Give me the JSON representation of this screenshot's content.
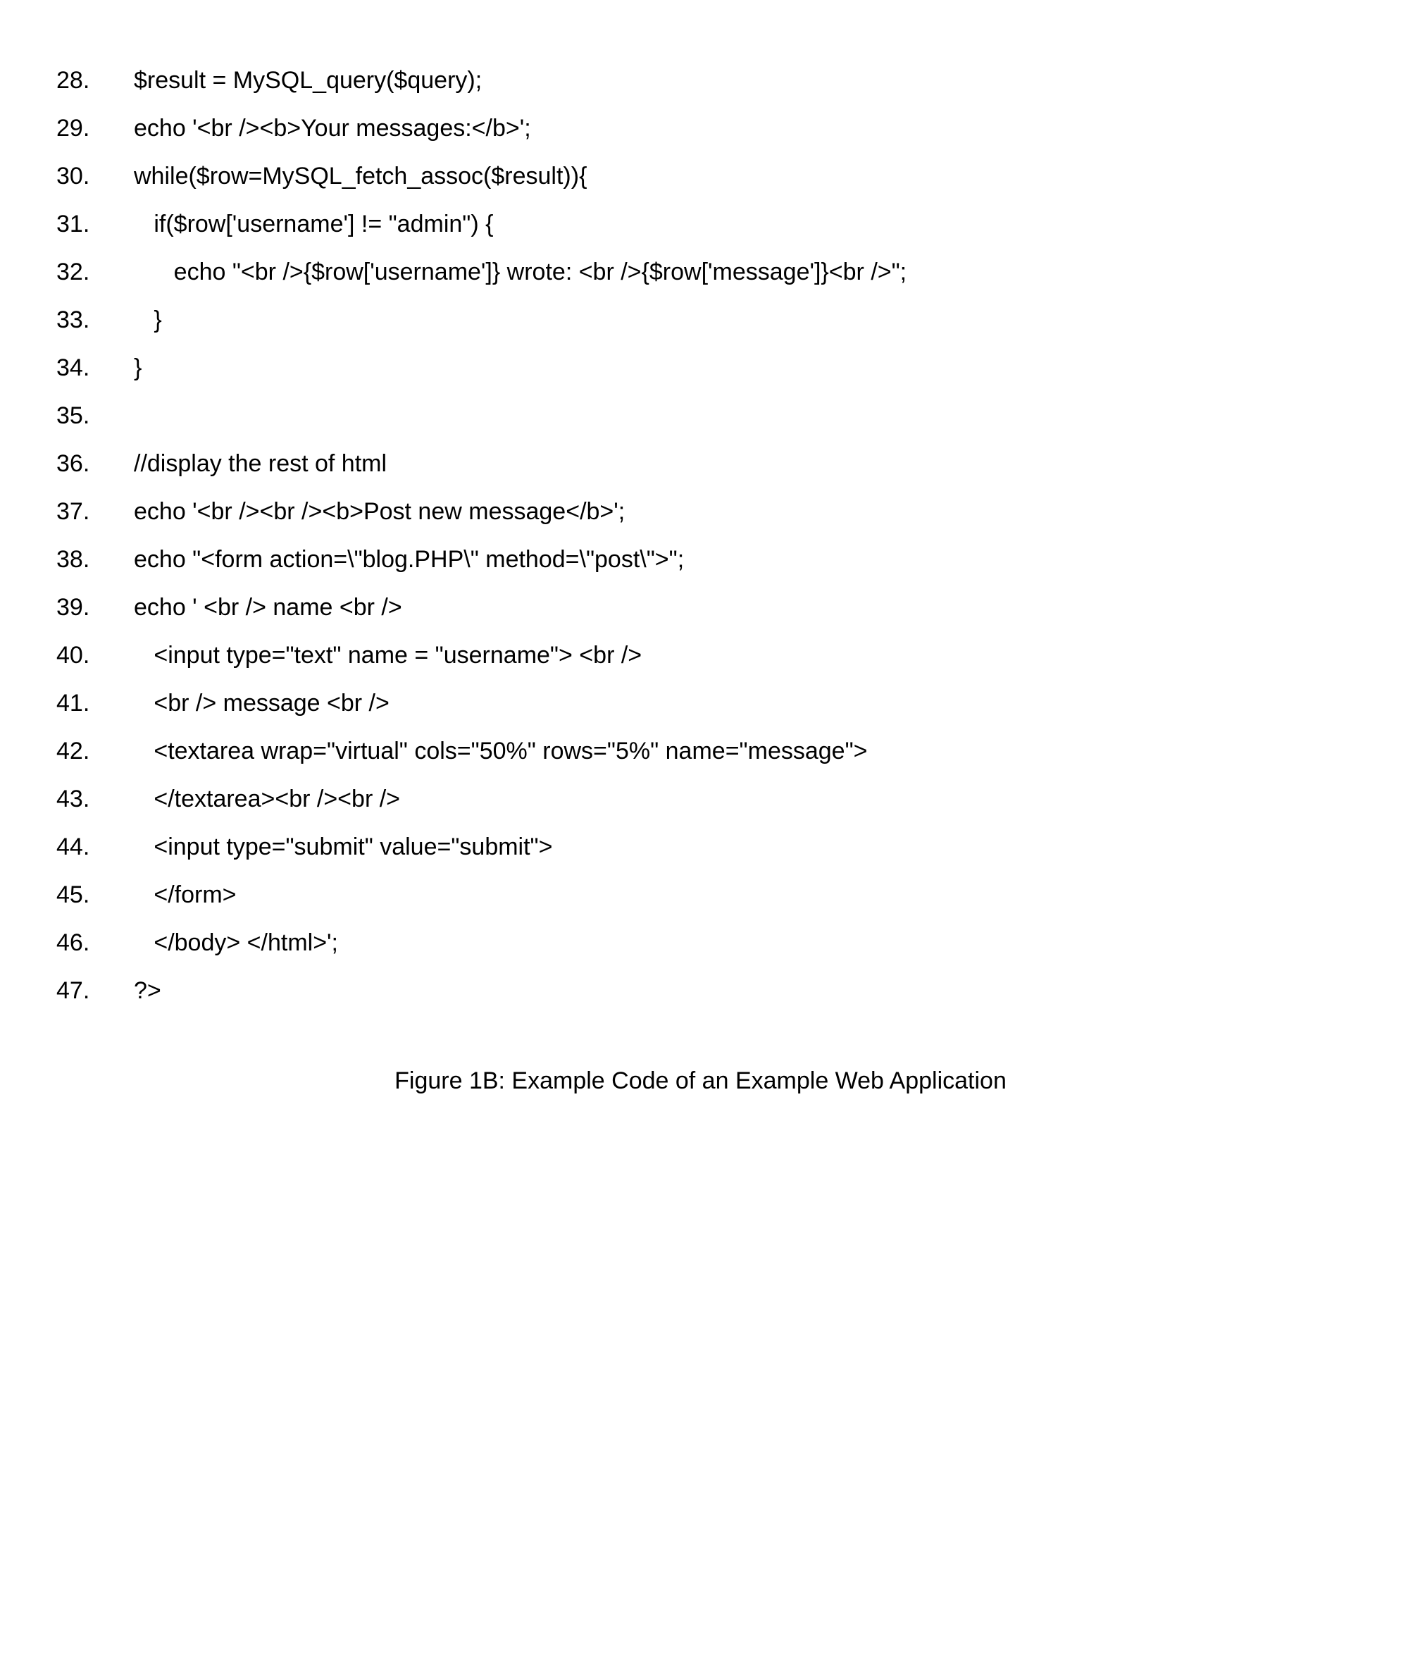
{
  "code": {
    "lines": [
      {
        "num": "28.",
        "text": "$result = MySQL_query($query);"
      },
      {
        "num": "29.",
        "text": "echo '<br /><b>Your messages:</b>';"
      },
      {
        "num": "30.",
        "text": "while($row=MySQL_fetch_assoc($result)){"
      },
      {
        "num": "31.",
        "text": "   if($row['username'] != \"admin\") {"
      },
      {
        "num": "32.",
        "text": "      echo \"<br />{$row['username']} wrote: <br />{$row['message']}<br />\";"
      },
      {
        "num": "33.",
        "text": "   }"
      },
      {
        "num": "34.",
        "text": "}"
      },
      {
        "num": "35.",
        "text": ""
      },
      {
        "num": "36.",
        "text": "//display the rest of html"
      },
      {
        "num": "37.",
        "text": "echo '<br /><br /><b>Post new message</b>';"
      },
      {
        "num": "38.",
        "text": "echo \"<form action=\\\"blog.PHP\\\" method=\\\"post\\\">\";"
      },
      {
        "num": "39.",
        "text": "echo ' <br /> name <br />"
      },
      {
        "num": "40.",
        "text": "   <input type=\"text\" name = \"username\"> <br />"
      },
      {
        "num": "41.",
        "text": "   <br /> message <br />"
      },
      {
        "num": "42.",
        "text": "   <textarea wrap=\"virtual\" cols=\"50%\" rows=\"5%\" name=\"message\">"
      },
      {
        "num": "43.",
        "text": "   </textarea><br /><br />"
      },
      {
        "num": "44.",
        "text": "   <input type=\"submit\" value=\"submit\">"
      },
      {
        "num": "45.",
        "text": "   </form>"
      },
      {
        "num": "46.",
        "text": "   </body> </html>';"
      },
      {
        "num": "47.",
        "text": "?>"
      }
    ]
  },
  "caption": "Figure 1B:  Example Code of an Example Web Application"
}
